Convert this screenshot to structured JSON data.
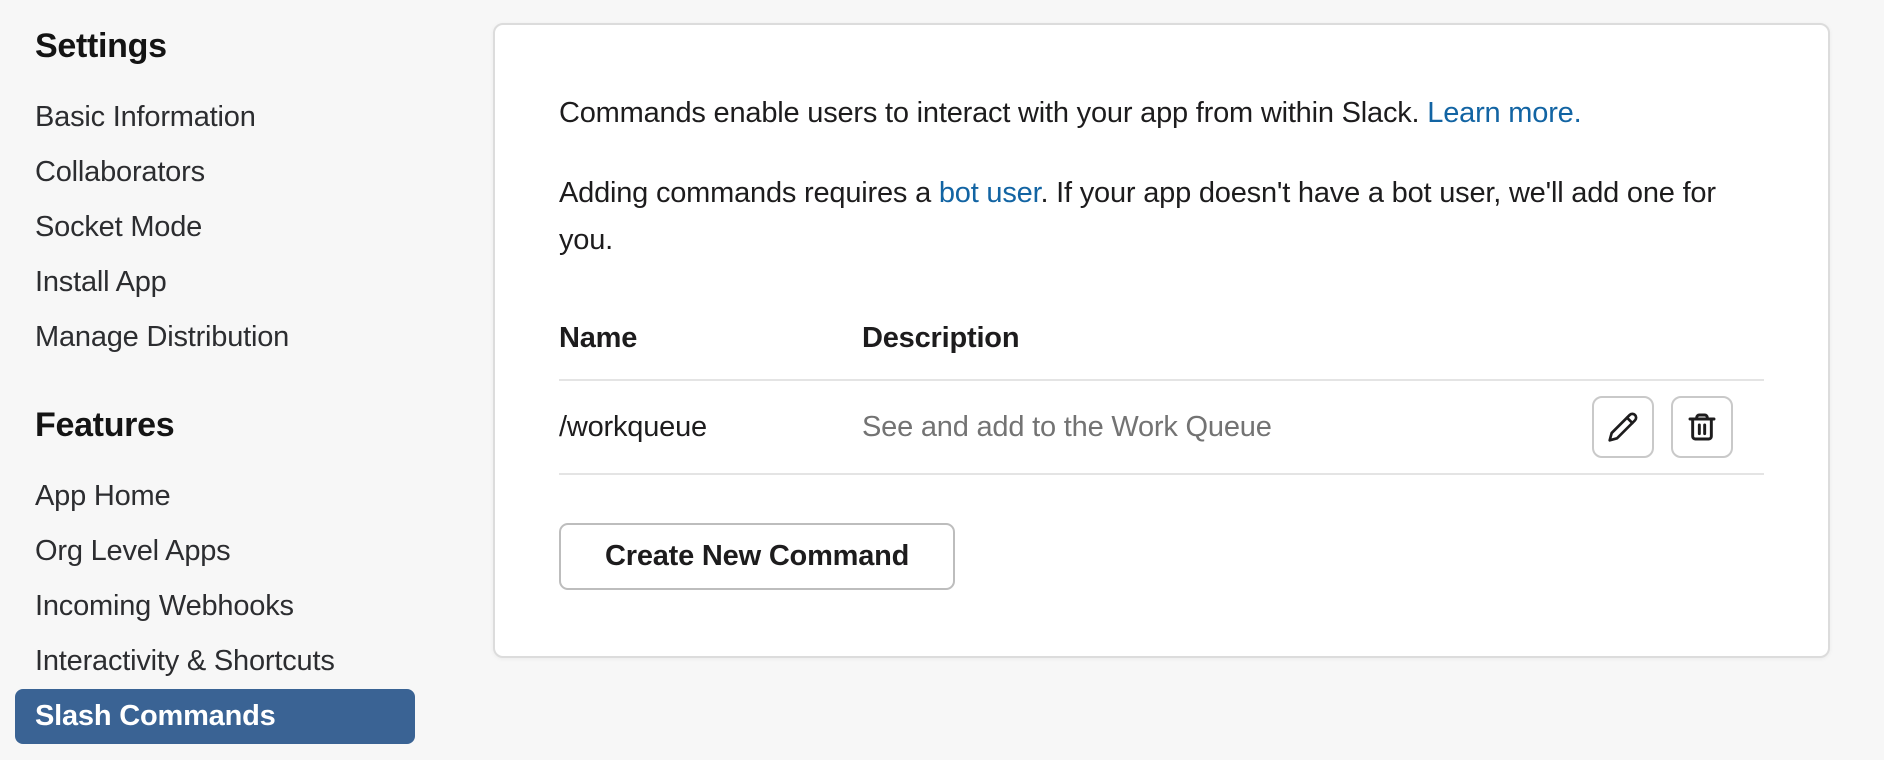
{
  "colors": {
    "page_bg": "#f7f7f7",
    "card_bg": "#ffffff",
    "card_border": "#dcdcdc",
    "accent_blue": "#3a6394",
    "link_blue": "#1264a3",
    "text_dark": "#1d1c1d",
    "text_gray": "#737373",
    "selected_text": "#ffffff"
  },
  "sidebar": {
    "sections": [
      {
        "heading": "Settings",
        "items": [
          {
            "label": "Basic Information",
            "selected": false
          },
          {
            "label": "Collaborators",
            "selected": false
          },
          {
            "label": "Socket Mode",
            "selected": false
          },
          {
            "label": "Install App",
            "selected": false
          },
          {
            "label": "Manage Distribution",
            "selected": false
          }
        ]
      },
      {
        "heading": "Features",
        "items": [
          {
            "label": "App Home",
            "selected": false
          },
          {
            "label": "Org Level Apps",
            "selected": false
          },
          {
            "label": "Incoming Webhooks",
            "selected": false
          },
          {
            "label": "Interactivity & Shortcuts",
            "selected": false
          },
          {
            "label": "Slash Commands",
            "selected": true
          }
        ]
      }
    ]
  },
  "main": {
    "intro_text": "Commands enable users to interact with your app from within Slack. ",
    "intro_link": "Learn more.",
    "note_before": "Adding commands requires a ",
    "note_link": "bot user",
    "note_after": ". If your app doesn't have a bot user, we'll add one for you.",
    "table": {
      "headers": {
        "name": "Name",
        "description": "Description"
      },
      "rows": [
        {
          "name": "/workqueue",
          "description": "See and add to the Work Queue"
        }
      ]
    },
    "icons": {
      "edit": "pencil-icon",
      "delete": "trash-icon"
    },
    "create_button_label": "Create New Command"
  }
}
